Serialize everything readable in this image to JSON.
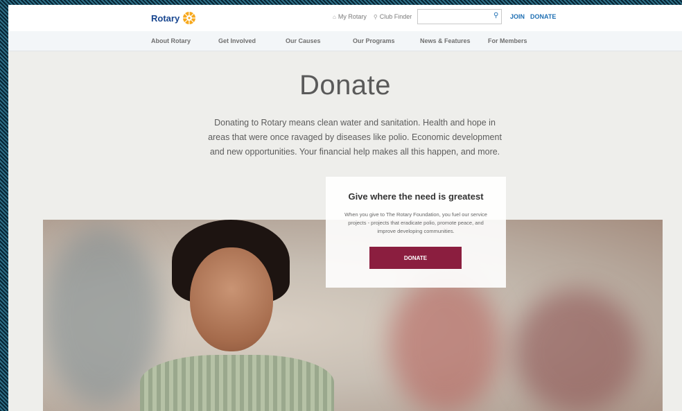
{
  "header": {
    "logo_text": "Rotary",
    "my_rotary": "My Rotary",
    "club_finder": "Club Finder",
    "search": {
      "placeholder": ""
    },
    "join": "JOIN",
    "donate": "DONATE"
  },
  "nav": {
    "items": [
      "About Rotary",
      "Get Involved",
      "Our Causes",
      "Our Programs",
      "News & Features",
      "For Members"
    ]
  },
  "main": {
    "title": "Donate",
    "intro": "Donating to Rotary means clean water and sanitation. Health and hope in areas that were once ravaged by diseases like polio. Economic development and new opportunities. Your financial help makes all this happen, and more."
  },
  "card": {
    "title": "Give where the need is greatest",
    "text": "When you give to The Rotary Foundation, you fuel our service projects - projects that eradicate polio, promote peace, and improve developing communities.",
    "button": "DONATE"
  },
  "icons": {
    "logo": "rotary-wheel-icon",
    "my_rotary": "person-icon",
    "club_finder": "location-pin-icon",
    "search": "search-icon"
  },
  "colors": {
    "brand_blue": "#17458f",
    "link_blue": "#1e6fb3",
    "donate_button": "#8b1e3f",
    "wheel_gold": "#f7a81b"
  }
}
